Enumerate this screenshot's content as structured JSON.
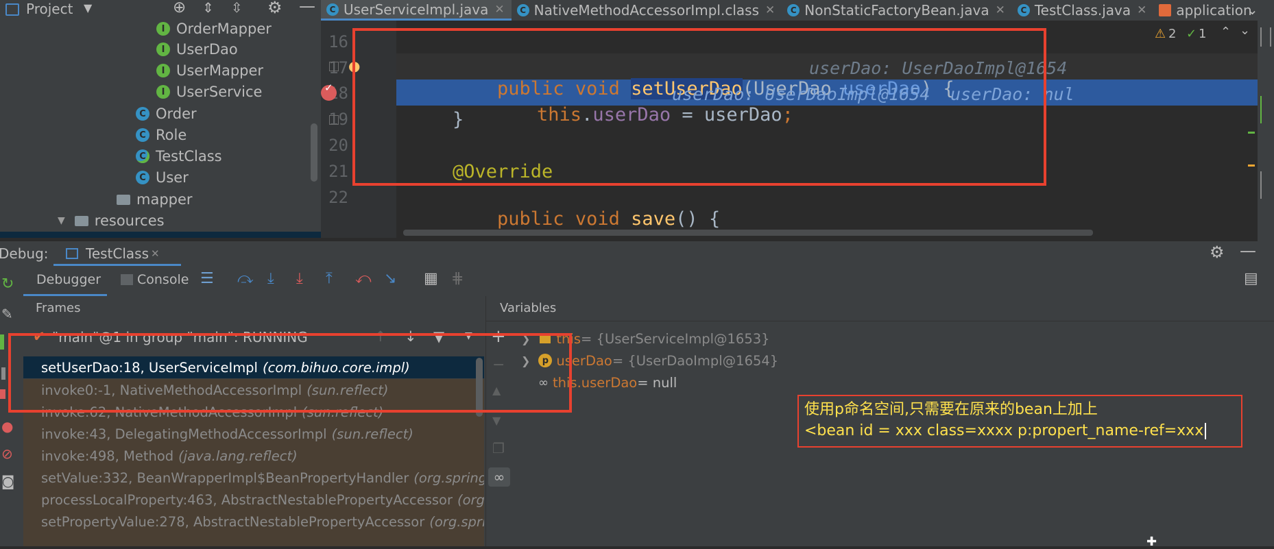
{
  "project": {
    "title": "Project",
    "items": [
      {
        "label": "OrderMapper",
        "kind": "interface"
      },
      {
        "label": "UserDao",
        "kind": "interface"
      },
      {
        "label": "UserMapper",
        "kind": "interface"
      },
      {
        "label": "UserService",
        "kind": "interface"
      },
      {
        "label": "Order",
        "kind": "class"
      },
      {
        "label": "Role",
        "kind": "class"
      },
      {
        "label": "TestClass",
        "kind": "class"
      },
      {
        "label": "User",
        "kind": "class"
      },
      {
        "label": "mapper",
        "kind": "folder"
      },
      {
        "label": "resources",
        "kind": "folder"
      }
    ]
  },
  "tabs": [
    {
      "label": "UserServiceImpl.java",
      "active": true
    },
    {
      "label": "NativeMethodAccessorImpl.class",
      "active": false
    },
    {
      "label": "NonStaticFactoryBean.java",
      "active": false
    },
    {
      "label": "TestClass.java",
      "active": false
    },
    {
      "label": "application",
      "active": false
    }
  ],
  "editor": {
    "inspection": {
      "warnings": "2",
      "ok": "1"
    },
    "line_numbers": [
      "16",
      "17",
      "18",
      "19",
      "20",
      "21",
      "22"
    ],
    "line17": {
      "kw1": "public",
      "kw2": "void",
      "method": "setUserDao",
      "open": "(",
      "type": "UserDao",
      "param": "userDao",
      "close": ") {",
      "hint": "userDao: UserDaoImpl@1654"
    },
    "line18": {
      "kw": "this",
      "dot": ".",
      "field": "userDao",
      "assign": " = userDao",
      "semi": ";",
      "hint1": "userDao: UserDaoImpl@1654",
      "hint2": "userDao: nul"
    },
    "line19": "}",
    "line21": "@Override",
    "line22": {
      "kw1": "public",
      "kw2": "void",
      "method": "save",
      "rest": "() {"
    }
  },
  "debug": {
    "label": "Debug:",
    "session": "TestClass",
    "tab_debugger": "Debugger",
    "tab_console": "Console",
    "frames_title": "Frames",
    "variables_title": "Variables",
    "thread": "\"main\"@1 in group \"main\": RUNNING",
    "frames": [
      {
        "method": "setUserDao:18, UserServiceImpl",
        "pkg": "(com.bihuo.core.impl)"
      },
      {
        "method": "invoke0:-1, NativeMethodAccessorImpl",
        "pkg": "(sun.reflect)"
      },
      {
        "method": "invoke:62, NativeMethodAccessorImpl",
        "pkg": "(sun.reflect)"
      },
      {
        "method": "invoke:43, DelegatingMethodAccessorImpl",
        "pkg": "(sun.reflect)"
      },
      {
        "method": "invoke:498, Method",
        "pkg": "(java.lang.reflect)"
      },
      {
        "method": "setValue:332, BeanWrapperImpl$BeanPropertyHandler",
        "pkg": "(org.springfr"
      },
      {
        "method": "processLocalProperty:463, AbstractNestablePropertyAccessor",
        "pkg": "(org.s"
      },
      {
        "method": "setPropertyValue:278, AbstractNestablePropertyAccessor",
        "pkg": "(org.spring"
      }
    ],
    "variables": [
      {
        "name": "this",
        "value": " = {UserServiceImpl@1653}"
      },
      {
        "name": "userDao",
        "value": " = {UserDaoImpl@1654}",
        "badge": "p"
      },
      {
        "name": "this.userDao",
        "value": " = null"
      }
    ]
  },
  "annotation": {
    "line1": "使用p命名空间,只需要在原来的bean上加上",
    "line2": "<bean id = xxx class=xxxx p:propert_name-ref=xxx"
  },
  "colors": {
    "accent": "#4a88c7",
    "selection": "#214283",
    "highlight": "#e8412f",
    "note_text": "#ffe14d"
  }
}
